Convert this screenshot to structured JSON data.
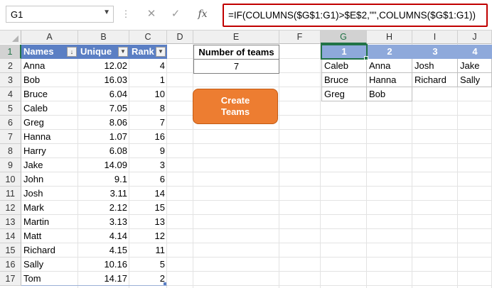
{
  "name_box": "G1",
  "formula": "=IF(COLUMNS($G$1:G1)>$E$2,\"\",COLUMNS($G$1:G1))",
  "icons": {
    "more": "vertical-dots-icon",
    "cancel": "cancel-x-icon",
    "enter": "checkmark-icon",
    "function": "fx-icon",
    "dropdown": "chevron-down-icon",
    "filter": "filter-dropdown-icon"
  },
  "columns": [
    "A",
    "B",
    "C",
    "D",
    "E",
    "F",
    "G",
    "H",
    "I",
    "J"
  ],
  "rows": [
    "1",
    "2",
    "3",
    "4",
    "5",
    "6",
    "7",
    "8",
    "9",
    "10",
    "11",
    "12",
    "13",
    "14",
    "15",
    "16",
    "17"
  ],
  "table": {
    "headers": [
      "Names",
      "Unique",
      "Rank"
    ],
    "rows": [
      [
        "Anna",
        "12.02",
        "4"
      ],
      [
        "Bob",
        "16.03",
        "1"
      ],
      [
        "Bruce",
        "6.04",
        "10"
      ],
      [
        "Caleb",
        "7.05",
        "8"
      ],
      [
        "Greg",
        "8.06",
        "7"
      ],
      [
        "Hanna",
        "1.07",
        "16"
      ],
      [
        "Harry",
        "6.08",
        "9"
      ],
      [
        "Jake",
        "14.09",
        "3"
      ],
      [
        "John",
        "9.1",
        "6"
      ],
      [
        "Josh",
        "3.11",
        "14"
      ],
      [
        "Mark",
        "2.12",
        "15"
      ],
      [
        "Martin",
        "3.13",
        "13"
      ],
      [
        "Matt",
        "4.14",
        "12"
      ],
      [
        "Richard",
        "4.15",
        "11"
      ],
      [
        "Sally",
        "10.16",
        "5"
      ],
      [
        "Tom",
        "14.17",
        "2"
      ]
    ]
  },
  "teams_input": {
    "label": "Number of teams",
    "value": "7"
  },
  "button": {
    "label": "Create Teams"
  },
  "teams": {
    "headers": [
      "1",
      "2",
      "3",
      "4"
    ],
    "rows": [
      [
        "Caleb",
        "Anna",
        "Josh",
        "Jake"
      ],
      [
        "Bruce",
        "Hanna",
        "Richard",
        "Sally"
      ],
      [
        "Greg",
        "Bob",
        "",
        ""
      ]
    ]
  },
  "colors": {
    "table_header": "#5b7fc4",
    "team_header": "#8ea9db",
    "button": "#ed7d31",
    "formula_border": "#c00000",
    "selection": "#217346"
  }
}
